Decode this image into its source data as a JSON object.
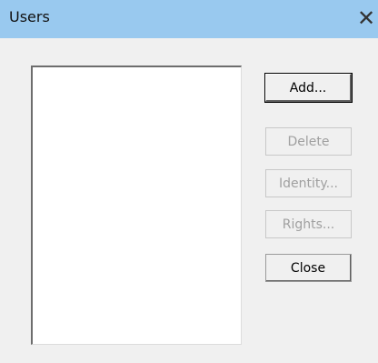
{
  "window": {
    "title": "Users",
    "close_glyph": "✕"
  },
  "users_list": {
    "items": []
  },
  "buttons": {
    "add": "Add...",
    "delete": "Delete",
    "identity": "Identity...",
    "rights": "Rights...",
    "close": "Close"
  },
  "colors": {
    "titlebar": "#99c9ef",
    "dialog_bg": "#f0f0f0",
    "disabled_text": "#a0a0a0"
  }
}
